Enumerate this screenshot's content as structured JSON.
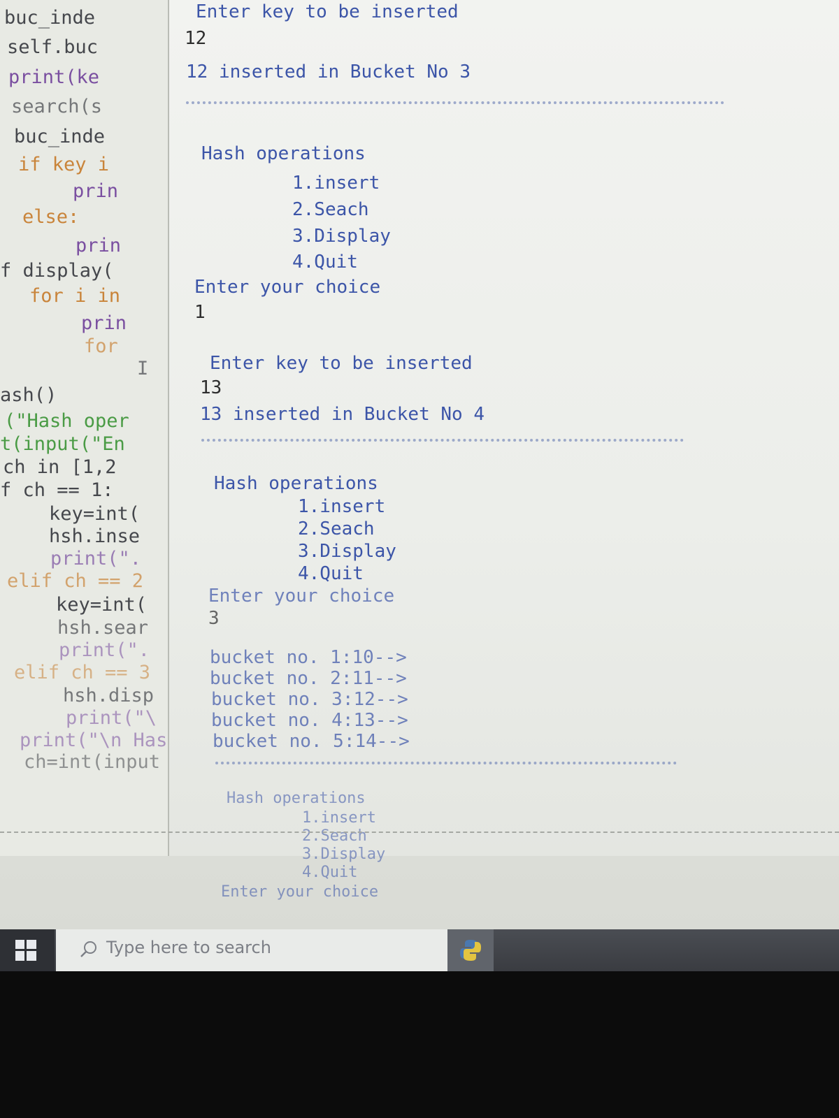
{
  "editor": {
    "lines": [
      "buc_inde",
      "self.buc",
      "print(ke",
      "search(s",
      "buc_inde",
      "if key i",
      "prin",
      "else:",
      "prin",
      "f display(",
      "for i in",
      "prin",
      "for",
      "I",
      "ash()",
      "(\"Hash oper",
      "t(input(\"En",
      "ch in [1,2",
      "f ch == 1:",
      "key=int(",
      "hsh.inse",
      "print(\".",
      "elif ch == 2",
      "key=int(",
      "hsh.sear",
      "print(\".",
      "elif ch == 3",
      "hsh.disp",
      "print(\"\\",
      "print(\"\\n Has",
      "ch=int(input"
    ]
  },
  "shell": {
    "block1": {
      "prompt_key": "Enter key to be inserted",
      "key_input": "12",
      "result": "12 inserted in Bucket No 3"
    },
    "menu1": {
      "title": "Hash operations",
      "items": [
        "1.insert",
        "2.Seach",
        "3.Display",
        "4.Quit"
      ],
      "prompt_choice": "Enter your choice",
      "choice_input": "1"
    },
    "block2": {
      "prompt_key": "Enter key to be inserted",
      "key_input": "13",
      "result": "13 inserted in Bucket No 4"
    },
    "menu2": {
      "title": "Hash operations",
      "items": [
        "1.insert",
        "2.Seach",
        "3.Display",
        "4.Quit"
      ],
      "prompt_choice": "Enter your choice",
      "choice_input": "3"
    },
    "buckets": [
      "bucket no. 1:10-->",
      "bucket no. 2:11-->",
      "bucket no. 3:12-->",
      "bucket no. 4:13-->",
      "bucket no. 5:14-->"
    ],
    "menu3": {
      "title": "Hash operations",
      "items": [
        "1.insert",
        "2.Seach",
        "3.Display",
        "4.Quit"
      ],
      "prompt_choice": "Enter your choice"
    }
  },
  "taskbar": {
    "search_placeholder": "Type here to search",
    "start_icon": "windows-logo-icon",
    "app_icon": "python-icon"
  },
  "colors": {
    "output_text": "#3c55a8",
    "taskbar": "#3a3c41"
  }
}
